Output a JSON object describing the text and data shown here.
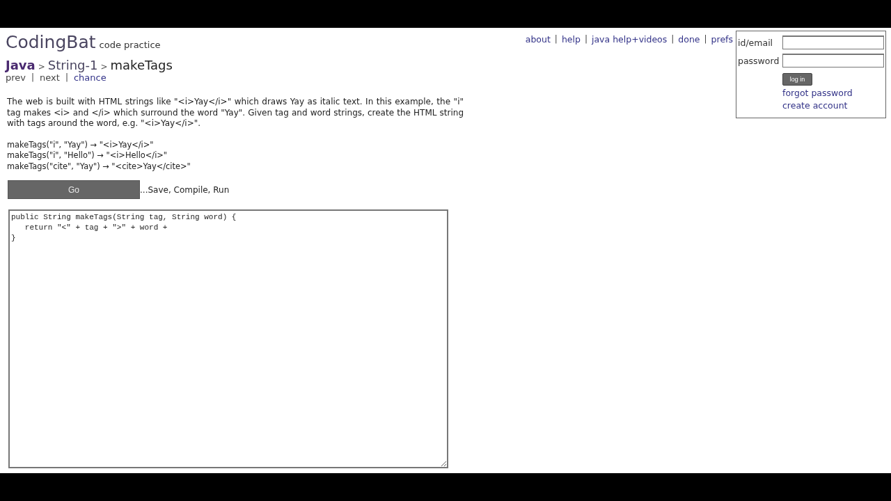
{
  "site": {
    "logo": "CodingBat",
    "tagline": "code practice"
  },
  "breadcrumb": [
    {
      "label": "Java",
      "current": false
    },
    {
      "label": ">",
      "kind": "sep"
    },
    {
      "label": "String-1",
      "current": false
    },
    {
      "label": ">",
      "kind": "sep"
    },
    {
      "label": "makeTags",
      "current": true
    }
  ],
  "pager": [
    {
      "label": "prev",
      "kind": "link"
    },
    {
      "label": "|",
      "kind": "sep"
    },
    {
      "label": "next",
      "kind": "link"
    },
    {
      "label": "|",
      "kind": "sep"
    },
    {
      "label": "chance",
      "kind": "link"
    }
  ],
  "top_links": [
    {
      "label": "about",
      "kind": "link"
    },
    {
      "label": "|",
      "kind": "sep"
    },
    {
      "label": "help",
      "kind": "link"
    },
    {
      "label": "|",
      "kind": "sep"
    },
    {
      "label": "java help+videos",
      "kind": "link"
    },
    {
      "label": "|",
      "kind": "sep"
    },
    {
      "label": "done",
      "kind": "link"
    },
    {
      "label": "|",
      "kind": "sep"
    },
    {
      "label": "prefs",
      "kind": "link"
    }
  ],
  "login": {
    "id_label": "id/email",
    "password_label": "password",
    "button": "log in",
    "links": [
      "forgot password",
      "create account"
    ]
  },
  "description": "The web is built with HTML strings like \"<i>Yay</i>\" which draws Yay as italic text. In this example, the \"i\" tag makes <i> and </i> which surround the word \"Yay\". Given tag and word strings, create the HTML string with tags around the word, e.g. \"<i>Yay</i>\".",
  "examples": [
    "makeTags(\"i\", \"Yay\") → \"<i>Yay</i>\"",
    "makeTags(\"i\", \"Hello\") → \"<i>Hello</i>\"",
    "makeTags(\"cite\", \"Yay\") → \"<cite>Yay</cite>\""
  ],
  "go_button": "Go",
  "go_hint": "...Save, Compile, Run",
  "code": [
    "public String makeTags(String tag, String word) {",
    "   return \"<\" + tag + \">\" + word +",
    "}"
  ]
}
